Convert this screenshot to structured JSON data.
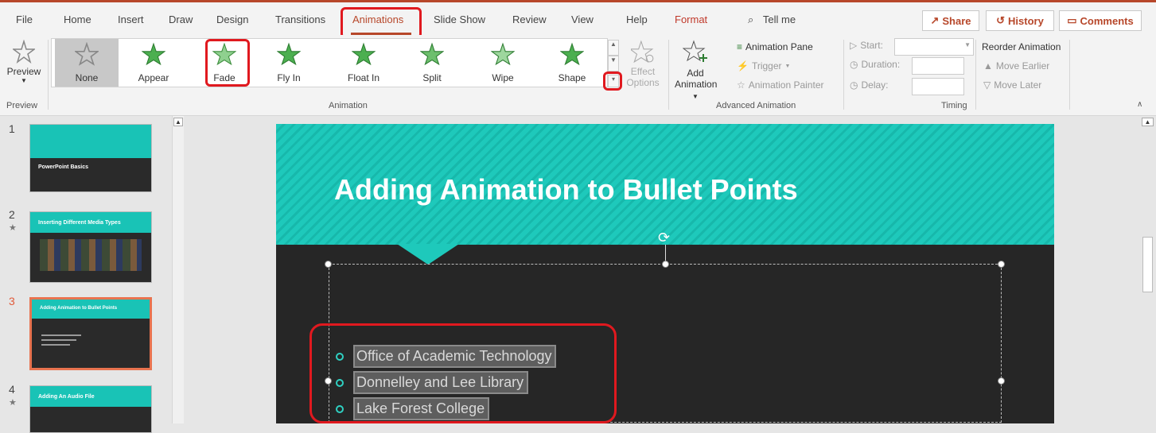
{
  "tabs": [
    {
      "label": "File"
    },
    {
      "label": "Home"
    },
    {
      "label": "Insert"
    },
    {
      "label": "Draw"
    },
    {
      "label": "Design"
    },
    {
      "label": "Transitions"
    },
    {
      "label": "Animations"
    },
    {
      "label": "Slide Show"
    },
    {
      "label": "Review"
    },
    {
      "label": "View"
    },
    {
      "label": "Help"
    },
    {
      "label": "Format"
    }
  ],
  "tell_me": "Tell me",
  "top_buttons": {
    "share": "Share",
    "history": "History",
    "comments": "Comments"
  },
  "ribbon": {
    "preview": {
      "label": "Preview",
      "group": "Preview"
    },
    "gallery": [
      "None",
      "Appear",
      "Fade",
      "Fly In",
      "Float In",
      "Split",
      "Wipe",
      "Shape"
    ],
    "effect_options": {
      "line1": "Effect",
      "line2": "Options"
    },
    "animation_group": "Animation",
    "add_animation": {
      "line1": "Add",
      "line2": "Animation"
    },
    "animation_pane": "Animation Pane",
    "trigger": "Trigger",
    "animation_painter": "Animation Painter",
    "advanced_group": "Advanced Animation",
    "start": "Start:",
    "duration": "Duration:",
    "delay": "Delay:",
    "timing_group": "Timing",
    "reorder": "Reorder Animation",
    "move_earlier": "Move Earlier",
    "move_later": "Move Later"
  },
  "slides": [
    {
      "num": "1",
      "title": "PowerPoint Basics",
      "star": ""
    },
    {
      "num": "2",
      "title": "Inserting Different Media Types",
      "star": "★"
    },
    {
      "num": "3",
      "title": "Adding Animation to Bullet Points",
      "star": ""
    },
    {
      "num": "4",
      "title": "Adding An Audio File",
      "star": "★"
    }
  ],
  "slide": {
    "title": "Adding Animation to Bullet Points",
    "bullets": [
      "Office of Academic Technology",
      "Donnelley and Lee Library",
      "Lake Forest College"
    ]
  },
  "colors": {
    "accent": "#b7472a",
    "teal": "#19c3b6",
    "highlight": "#e0191f"
  }
}
